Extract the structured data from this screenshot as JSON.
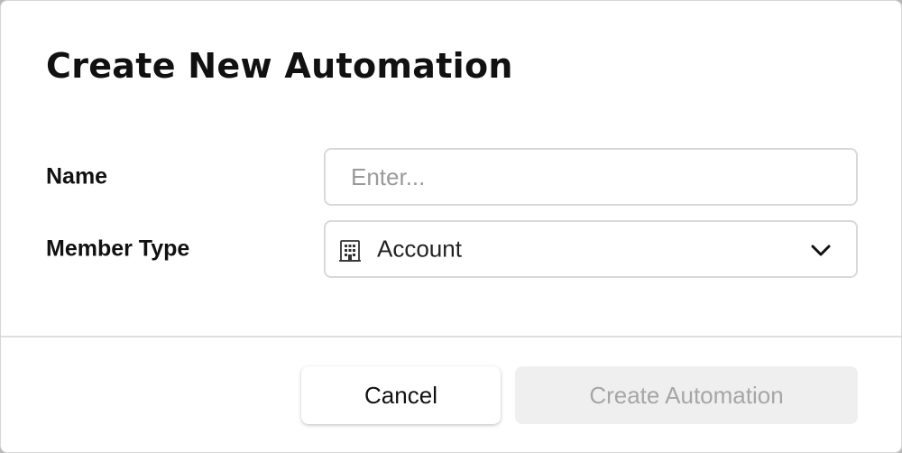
{
  "dialog": {
    "title": "Create New Automation"
  },
  "form": {
    "name": {
      "label": "Name",
      "value": "",
      "placeholder": "Enter..."
    },
    "member_type": {
      "label": "Member Type",
      "selected": "Account",
      "icon": "building-icon"
    }
  },
  "footer": {
    "cancel_label": "Cancel",
    "create_label": "Create Automation",
    "create_disabled": true
  },
  "colors": {
    "text": "#111111",
    "border": "#d9d9d9",
    "disabled_bg": "#efefef",
    "disabled_text": "#a6a6a6"
  }
}
